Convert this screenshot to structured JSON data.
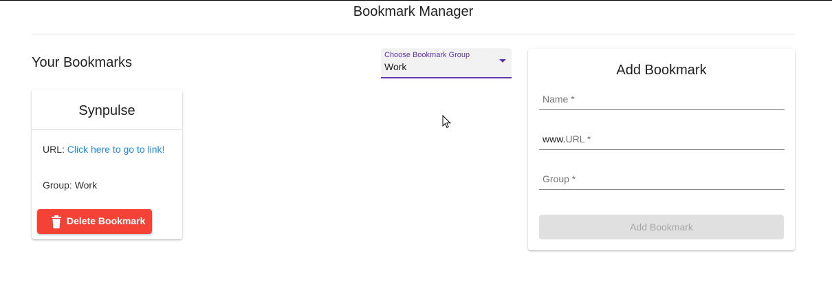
{
  "header": {
    "title": "Bookmark Manager"
  },
  "bookmarks_section": {
    "title": "Your Bookmarks"
  },
  "group_select": {
    "label": "Choose Bookmark Group",
    "value": "Work"
  },
  "bookmark_cards": [
    {
      "title": "Synpulse",
      "url_prefix": "URL:",
      "url_link_text": "Click here to go to link!",
      "group_text": "Group: Work",
      "delete_label": "Delete Bookmark",
      "delete_icon": "trash-icon"
    }
  ],
  "add_form": {
    "title": "Add Bookmark",
    "name_placeholder": "Name *",
    "url_prefix": "www.",
    "url_placeholder": "URL *",
    "group_placeholder": "Group *",
    "submit_label": "Add Bookmark",
    "submit_disabled": true
  },
  "colors": {
    "accent": "#5e35b1",
    "delete": "#f44336",
    "link": "#1e88e5",
    "disabled_bg": "#e0e0e0"
  }
}
